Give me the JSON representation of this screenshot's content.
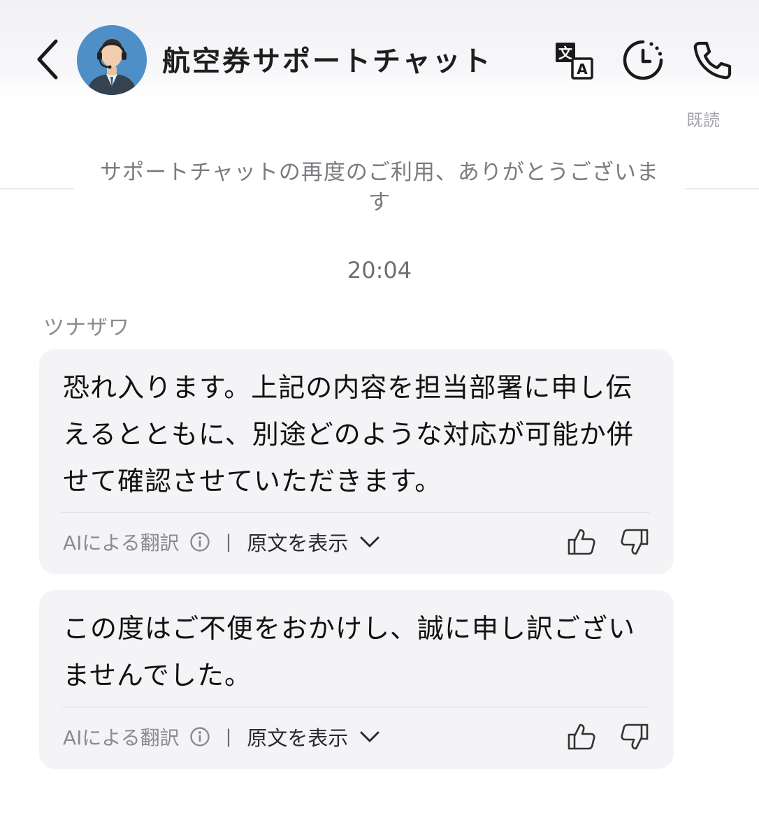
{
  "header": {
    "title": "航空券サポートチャット",
    "back_icon": "chevron-left-icon",
    "translate_icon": "translate-icon",
    "history_icon": "history-clock-icon",
    "call_icon": "phone-icon"
  },
  "read_status": "既読",
  "system_message": "サポートチャットの再度のご利用、ありがとうございます",
  "timestamp": "20:04",
  "sender": {
    "name": "ツナザワ"
  },
  "messages": [
    {
      "text": "恐れ入ります。上記の内容を担当部署に申し伝えるとともに、別途どのような対応が可能か併せて確認させていただきます。",
      "ai_label": "AIによる翻訳",
      "separator": "|",
      "show_original_label": "原文を表示"
    },
    {
      "text": "この度はご不便をおかけし、誠に申し訳ございませんでした。",
      "ai_label": "AIによる翻訳",
      "separator": "|",
      "show_original_label": "原文を表示"
    }
  ],
  "colors": {
    "bubble_background": "#f4f4f7",
    "header_background": "#f2f2f6",
    "secondary_text": "#8a8a8f",
    "avatar_background": "#4f8fc8"
  }
}
